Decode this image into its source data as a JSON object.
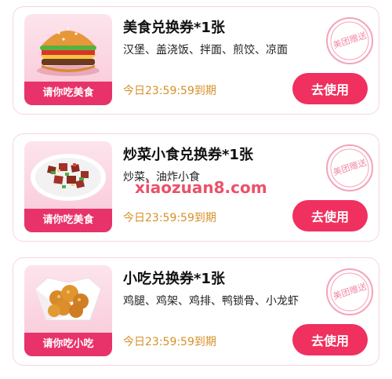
{
  "coupons": [
    {
      "thumb_label": "请你吃美食",
      "title": "美食兑换券*1张",
      "description": "汉堡、盖浇饭、拌面、煎饺、凉面",
      "expiry": "今日23:59:59到期",
      "button_label": "去使用",
      "stamp_text": "美团赠送",
      "image": "burger"
    },
    {
      "thumb_label": "请你吃美食",
      "title": "炒菜小食兑换券*1张",
      "description": "炒菜、油炸小食",
      "expiry": "今日23:59:59到期",
      "button_label": "去使用",
      "stamp_text": "美团赠送",
      "image": "stir-fry-plate"
    },
    {
      "thumb_label": "请你吃小吃",
      "title": "小吃兑换券*1张",
      "description": "鸡腿、鸡架、鸡排、鸭锁骨、小龙虾",
      "expiry": "今日23:59:59到期",
      "button_label": "去使用",
      "stamp_text": "美团赠送",
      "image": "fried-chicken-box"
    }
  ],
  "watermark": "xiaozuan8.com",
  "colors": {
    "accent": "#f0305e",
    "expiry": "#d69027",
    "card_border": "#f6d5dd"
  }
}
